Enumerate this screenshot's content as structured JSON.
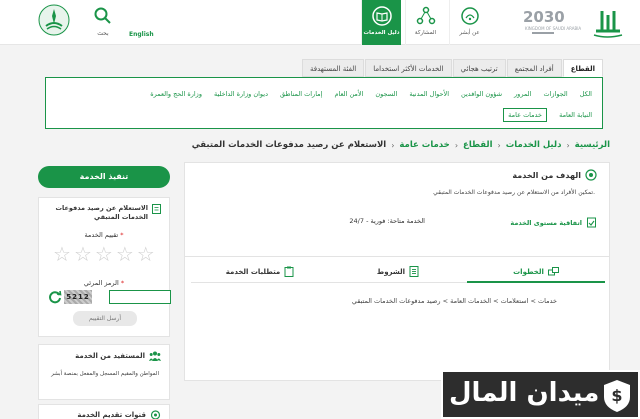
{
  "header": {
    "search_label": "بحث",
    "lang_label": "English",
    "nav": [
      {
        "label": "دليل الخدمات"
      },
      {
        "label": "المشاركة"
      },
      {
        "label": "عن أبشر"
      }
    ]
  },
  "sector": {
    "tabs": [
      {
        "label": "القطاع"
      },
      {
        "label": "أفراد المجتمع"
      },
      {
        "label": "ترتيب هجائي"
      },
      {
        "label": "الخدمات الأكثر استخداما"
      },
      {
        "label": "الفئة المستهدفة"
      }
    ],
    "row1": [
      "الكل",
      "الجوازات",
      "المرور",
      "شؤون الوافدين",
      "الأحوال المدنية",
      "السجون",
      "الأمن العام",
      "إمارات المناطق",
      "ديوان وزارة الداخلية",
      "وزارة الحج والعمرة"
    ],
    "row2": [
      "النيابة العامة",
      "خدمات عامة"
    ]
  },
  "breadcrumb": {
    "items": [
      "الرئيسية",
      "دليل الخدمات",
      "القطاع",
      "خدمات عامة"
    ],
    "current": "الاستعلام عن رصيد مدفوعات الخدمات المتبقي"
  },
  "goal": {
    "title": "الهدف من الخدمة",
    "text": "تمكين الأفراد من الاستعلام عن رصيد مدفوعات الخدمات المتبقي.",
    "service_level": "اتفاقية مستوى الخدمة",
    "availability": "الخدمة متاحة: فورية - 24/7"
  },
  "details": {
    "tabs": [
      {
        "label": "الخطوات"
      },
      {
        "label": "الشروط"
      },
      {
        "label": "متطلبات الخدمة"
      }
    ],
    "steps": "خدمات > استعلامات > الخدمات العامة > رصيد مدفوعات الخدمات المتبقي"
  },
  "sidebar": {
    "execute": "تنفيذ الخدمة",
    "service_name": "الاستعلام عن رصيد مدفوعات الخدمات المتبقي",
    "rating_label": "تقييم الخدمة",
    "code_label": "الرمز المرئي",
    "captcha": "5212",
    "send": "أرسل التقييم",
    "beneficiary_title": "المستفيد من الخدمة",
    "beneficiary_text": "المواطن والمقيم المسجل والمفعل بمنصة أبشر",
    "channels_title": "قنوات تقديم الخدمة"
  },
  "watermark": {
    "text": "ميدان المال"
  },
  "colors": {
    "accent": "#1a9448",
    "dark": "#2d2d2d"
  }
}
